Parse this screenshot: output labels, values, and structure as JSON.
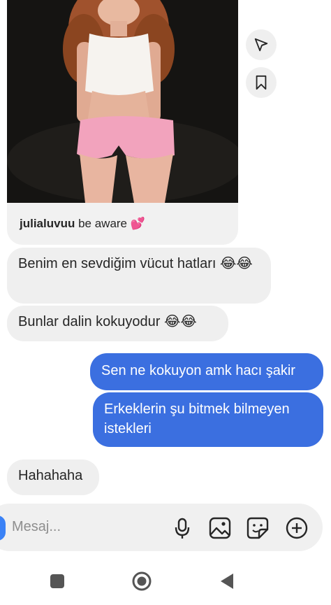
{
  "shared_post": {
    "username": "julialuvuu",
    "caption": "be aware 💕"
  },
  "side_actions": [
    "share-icon",
    "bookmark-icon"
  ],
  "messages": [
    {
      "direction": "incoming",
      "text": "Benim en sevdiğim vücut hatları 😂😂"
    },
    {
      "direction": "incoming",
      "text": "Bunlar dalin kokuyodur 😂😂"
    },
    {
      "direction": "outgoing",
      "text": "Sen ne kokuyon amk hacı şakir"
    },
    {
      "direction": "outgoing",
      "text": "Erkeklerin şu bitmek bilmeyen istekleri"
    },
    {
      "direction": "incoming",
      "text": "Hahahaha"
    }
  ],
  "composer": {
    "placeholder": "Mesaj...",
    "icons": [
      "microphone-icon",
      "gallery-icon",
      "sticker-icon",
      "plus-icon"
    ]
  },
  "navbar": {
    "icons": [
      "recents-square-icon",
      "home-circle-icon",
      "back-triangle-icon"
    ]
  },
  "colors": {
    "outgoing_bubble": "#3b6fe0",
    "incoming_bubble": "#efefef",
    "composer_bg": "#f0f0f0",
    "accent": "#3b82f6"
  }
}
